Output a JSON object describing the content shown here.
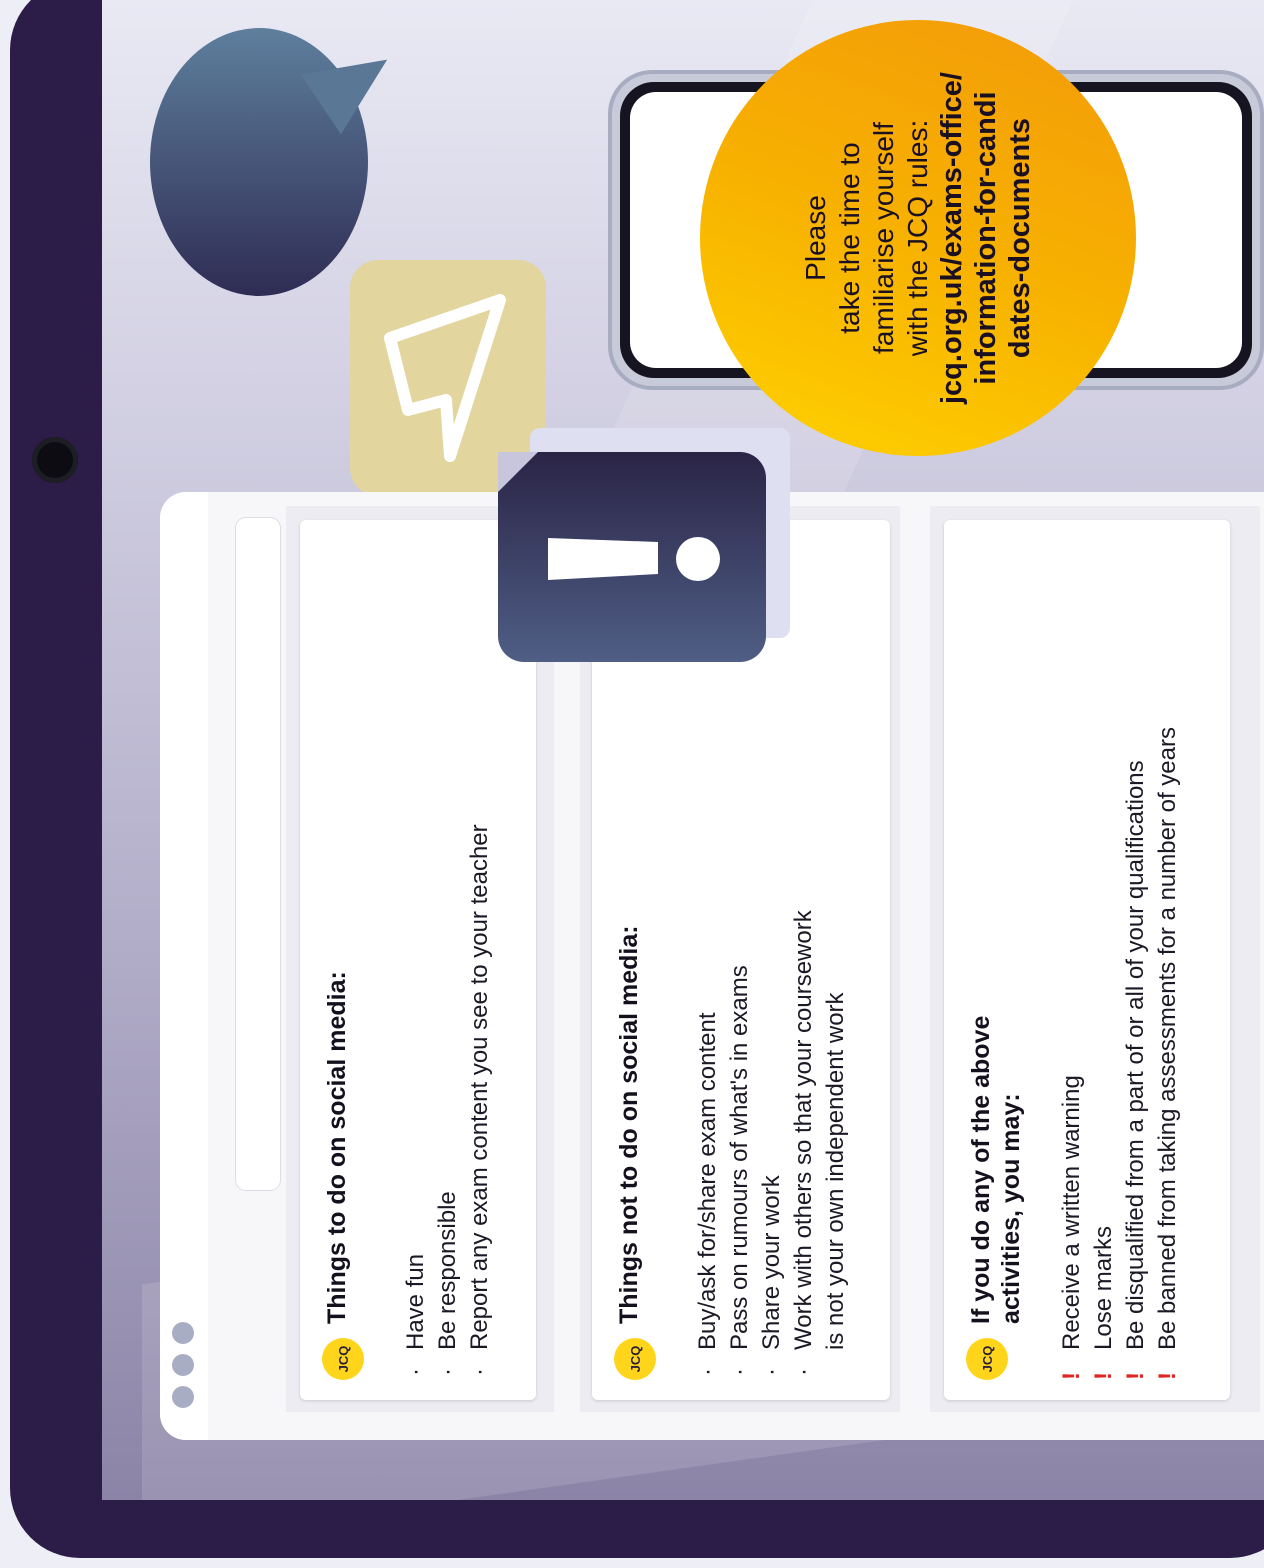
{
  "info_circle": {
    "lines": [
      "Please",
      "take the time to",
      "familiarise yourself",
      "with the JCQ rules:"
    ],
    "link_lines": [
      "jcq.org.uk/exams-office/",
      "information-for-candi",
      "dates-documents"
    ]
  },
  "cards": [
    {
      "logo": "JCQ",
      "title": "Things to do on social media:",
      "bullet": "·",
      "items": [
        "Have fun",
        "Be responsible",
        "Report any exam content you see to your teacher"
      ]
    },
    {
      "logo": "JCQ",
      "title": "Things not to do on social media:",
      "bullet": "·",
      "items": [
        "Buy/ask for/share exam content",
        "Pass on rumours of what's in exams",
        "Share your work"
      ],
      "last_item": [
        "Work with others so that your coursework",
        "is not your own independent work"
      ]
    },
    {
      "logo": "JCQ",
      "title_lines": [
        "If you do any of the above",
        "activities, you may:"
      ],
      "marker": "!",
      "items": [
        "Receive a written warning",
        "Lose marks",
        "Be disqualified from a part of or all of your qualifications",
        "Be banned from taking assessments for a number of years"
      ]
    }
  ],
  "colors": {
    "frame": "#2c1d48",
    "circle": "#f7b100",
    "warning": "#e02424",
    "logo": "#ffd51c"
  }
}
